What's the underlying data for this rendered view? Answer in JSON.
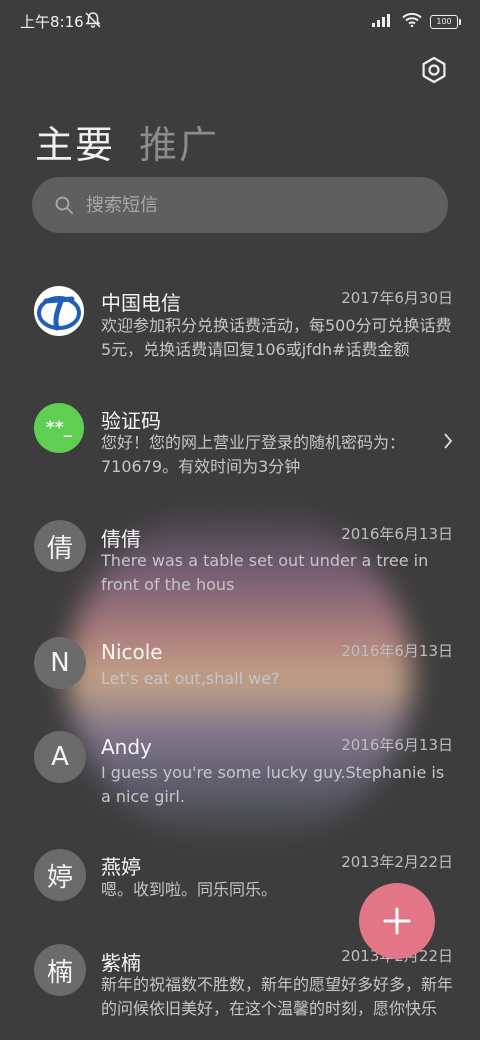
{
  "status_bar": {
    "time": "上午8:16",
    "battery": "100"
  },
  "tabs": [
    {
      "label": "主要"
    },
    {
      "label": "推广"
    }
  ],
  "search": {
    "placeholder": "搜索短信"
  },
  "conversations": [
    {
      "name": "中国电信",
      "date": "2017年6月30日",
      "preview": "欢迎参加积分兑换话费活动，每500分可兑换话费5元，兑换话费请回复106或jfdh#话费金额",
      "avatar": "telecom-logo"
    },
    {
      "name": "验证码",
      "date": "",
      "preview": "您好！您的网上营业厅登录的随机密码为：710679。有效时间为3分钟",
      "avatar_text": "**_"
    },
    {
      "name": "倩倩",
      "date": "2016年6月13日",
      "preview": "There was a table set out under a tree in front of the hous",
      "avatar_text": "倩"
    },
    {
      "name": "Nicole",
      "date": "2016年6月13日",
      "preview": "Let's eat out,shall we?",
      "avatar_text": "N"
    },
    {
      "name": "Andy",
      "date": "2016年6月13日",
      "preview": "I guess you're some lucky guy.Stephanie is a nice girl.",
      "avatar_text": "A"
    },
    {
      "name": "燕婷",
      "date": "2013年2月22日",
      "preview": "嗯。收到啦。同乐同乐。",
      "avatar_text": "婷"
    },
    {
      "name": "紫楠",
      "date": "2013年2月22日",
      "preview": "新年的祝福数不胜数，新年的愿望好多好多，新年的问候依旧美好，在这个温馨的时刻，愿你快乐",
      "avatar_text": "楠"
    }
  ],
  "colors": {
    "fab": "#e27686",
    "background": "#3d3d3d",
    "verify_avatar": "#5fcf53",
    "telecom_blue": "#1f5fb8"
  }
}
